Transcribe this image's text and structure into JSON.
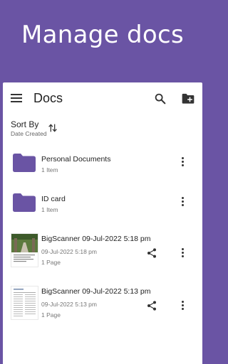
{
  "banner": {
    "title": "Manage docs"
  },
  "appbar": {
    "title": "Docs",
    "menu_icon": "menu-icon",
    "search_icon": "search-icon",
    "new_folder_icon": "create-new-folder-icon"
  },
  "sort": {
    "label": "Sort By",
    "value": "Date Created",
    "icon": "swap-vertical-icon"
  },
  "items": [
    {
      "kind": "folder",
      "title": "Personal Documents",
      "sub1": "1 Item"
    },
    {
      "kind": "folder",
      "title": "ID card",
      "sub1": "1 Item"
    },
    {
      "kind": "document",
      "title": "BigScanner 09-Jul-2022 5:18 pm",
      "sub1": "09-Jul-2022 5:18 pm",
      "sub2": "1 Page"
    },
    {
      "kind": "document",
      "title": "BigScanner 09-Jul-2022 5:13 pm",
      "sub1": "09-Jul-2022 5:13 pm",
      "sub2": "1 Page"
    }
  ],
  "colors": {
    "brand": "#6a54a4",
    "folder": "#6a54a4"
  }
}
